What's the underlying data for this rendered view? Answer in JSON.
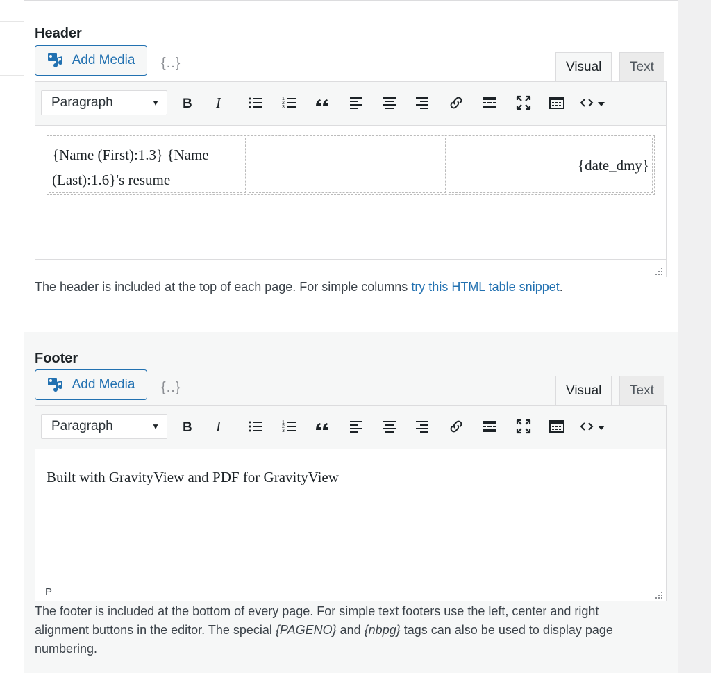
{
  "header": {
    "label": "Header",
    "add_media_label": "Add Media",
    "merge_tag_label": "{..}",
    "tabs": {
      "visual": "Visual",
      "text": "Text"
    },
    "format_select": "Paragraph",
    "table_cells": [
      "{Name (First):1.3} {Name (Last):1.6}'s resume",
      "",
      "{date_dmy}"
    ],
    "status_path": "",
    "help_text": "The header is included at the top of each page. For simple columns ",
    "help_link": "try this HTML table snippet",
    "help_end": "."
  },
  "footer": {
    "label": "Footer",
    "add_media_label": "Add Media",
    "merge_tag_label": "{..}",
    "tabs": {
      "visual": "Visual",
      "text": "Text"
    },
    "format_select": "Paragraph",
    "content_text": "Built with GravityView and PDF for GravityView",
    "status_path": "P",
    "help_part1": "The footer is included at the bottom of every page. For simple text footers use the left, center and right alignment buttons in the editor. The special ",
    "help_tag1": "{PAGENO}",
    "help_part2": " and ",
    "help_tag2": "{nbpg}",
    "help_part3": " tags can also be used to display page numbering."
  },
  "toolbar_icons": [
    "bold-icon",
    "italic-icon",
    "bulleted-list-icon",
    "numbered-list-icon",
    "blockquote-icon",
    "align-left-icon",
    "align-center-icon",
    "align-right-icon",
    "link-icon",
    "read-more-icon",
    "fullscreen-icon",
    "toolbar-toggle-icon",
    "code-icon"
  ],
  "colors": {
    "accent": "#2271b1",
    "text": "#1d2327",
    "border": "#dcdcde"
  }
}
